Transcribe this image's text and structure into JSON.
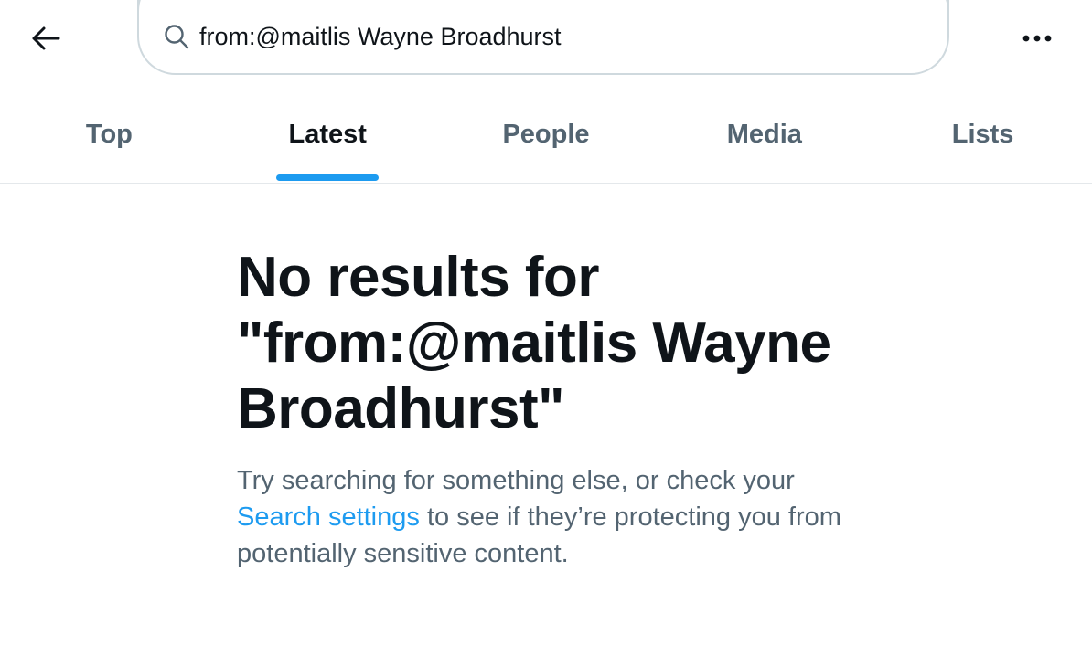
{
  "header": {
    "search": {
      "value": "from:@maitlis Wayne Broadhurst",
      "placeholder": "Search"
    }
  },
  "tabs": [
    {
      "label": "Top",
      "active": false
    },
    {
      "label": "Latest",
      "active": true
    },
    {
      "label": "People",
      "active": false
    },
    {
      "label": "Media",
      "active": false
    },
    {
      "label": "Lists",
      "active": false
    }
  ],
  "empty_state": {
    "title": "No results for \"from:@maitlis Wayne Broadhurst\"",
    "desc_before": "Try searching for something else, or check your",
    "link_text": "Search settings",
    "desc_after": "to see if they’re protecting you from potentially sensitive content."
  },
  "colors": {
    "accent": "#1d9bf0",
    "text_primary": "#0f1419",
    "text_secondary": "#536471",
    "border": "#cfd9de"
  },
  "icons": {
    "back": "arrow-left-icon",
    "search": "search-icon",
    "more": "more-horizontal-icon"
  }
}
